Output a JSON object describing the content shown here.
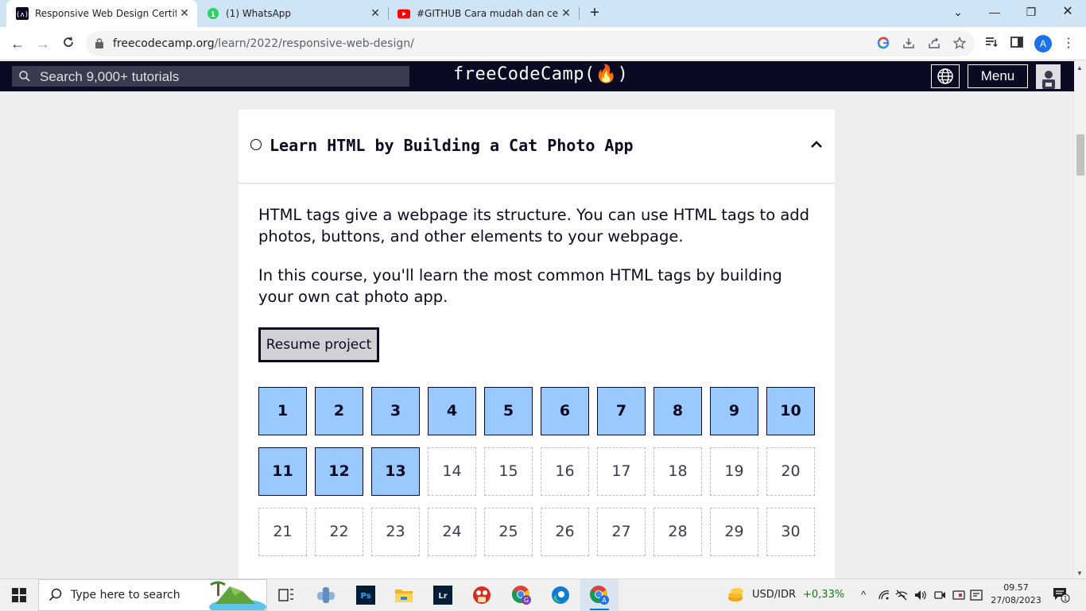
{
  "browser": {
    "tabs": [
      {
        "title": "Responsive Web Design Certificat",
        "favicon": "freecodecamp-icon",
        "active": true
      },
      {
        "title": "(1) WhatsApp",
        "favicon": "whatsapp-icon",
        "badge": "1"
      },
      {
        "title": "#GITHUB Cara mudah dan cepat",
        "favicon": "youtube-icon"
      }
    ],
    "url_host": "freecodecamp.org",
    "url_path": "/learn/2022/responsive-web-design/",
    "profile_initial": "A"
  },
  "header": {
    "search_placeholder": "Search 9,000+ tutorials",
    "logo": "freeCodeCamp(🔥)",
    "menu_label": "Menu"
  },
  "block": {
    "title": "Learn HTML by Building a Cat Photo App",
    "intro": [
      "HTML tags give a webpage its structure. You can use HTML tags to add photos, buttons, and other elements to your webpage.",
      "In this course, you'll learn the most common HTML tags by building your own cat photo app."
    ],
    "resume_label": "Resume project",
    "steps": [
      "1",
      "2",
      "3",
      "4",
      "5",
      "6",
      "7",
      "8",
      "9",
      "10",
      "11",
      "12",
      "13",
      "14",
      "15",
      "16",
      "17",
      "18",
      "19",
      "20",
      "21",
      "22",
      "23",
      "24",
      "25",
      "26",
      "27",
      "28",
      "29",
      "30"
    ],
    "completed_count": 13
  },
  "taskbar": {
    "search_placeholder": "Type here to search",
    "currency_pair": "USD/IDR",
    "currency_change": "+0,33%",
    "currency_change_color": "#107c10",
    "time": "09.57",
    "date": "27/08/2023",
    "notification_count": "1"
  },
  "colors": {
    "fcc_dark": "#0a0a23",
    "step_done": "#99c9ff",
    "tabstrip": "#cfe4f5"
  }
}
